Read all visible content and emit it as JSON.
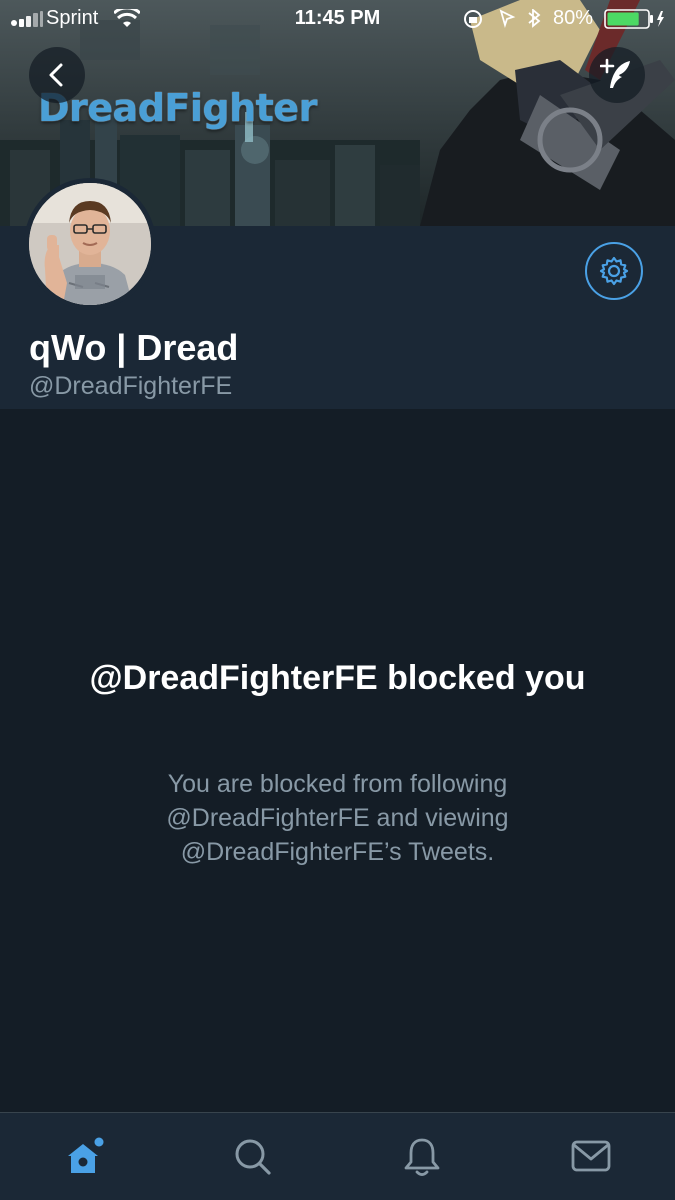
{
  "status_bar": {
    "carrier": "Sprint",
    "time": "11:45 PM",
    "battery_percent": "80%",
    "battery_level": 0.8
  },
  "banner": {
    "title": "DreadFighter"
  },
  "profile": {
    "display_name": "qWo | Dread",
    "handle": "@DreadFighterFE"
  },
  "blocked": {
    "title": "@DreadFighterFE blocked you",
    "description": "You are blocked from following @DreadFighterFE and viewing @DreadFighterFE’s Tweets."
  },
  "icons": {
    "back": "chevron-left-icon",
    "compose": "compose-tweet-icon",
    "settings": "gear-icon",
    "tabs": [
      "home-icon",
      "search-icon",
      "bell-icon",
      "mail-icon"
    ]
  },
  "colors": {
    "accent": "#4aa1e6",
    "background": "#141d26",
    "header": "#1b2836",
    "secondary_text": "#8899a6",
    "battery_green": "#4cd964"
  }
}
